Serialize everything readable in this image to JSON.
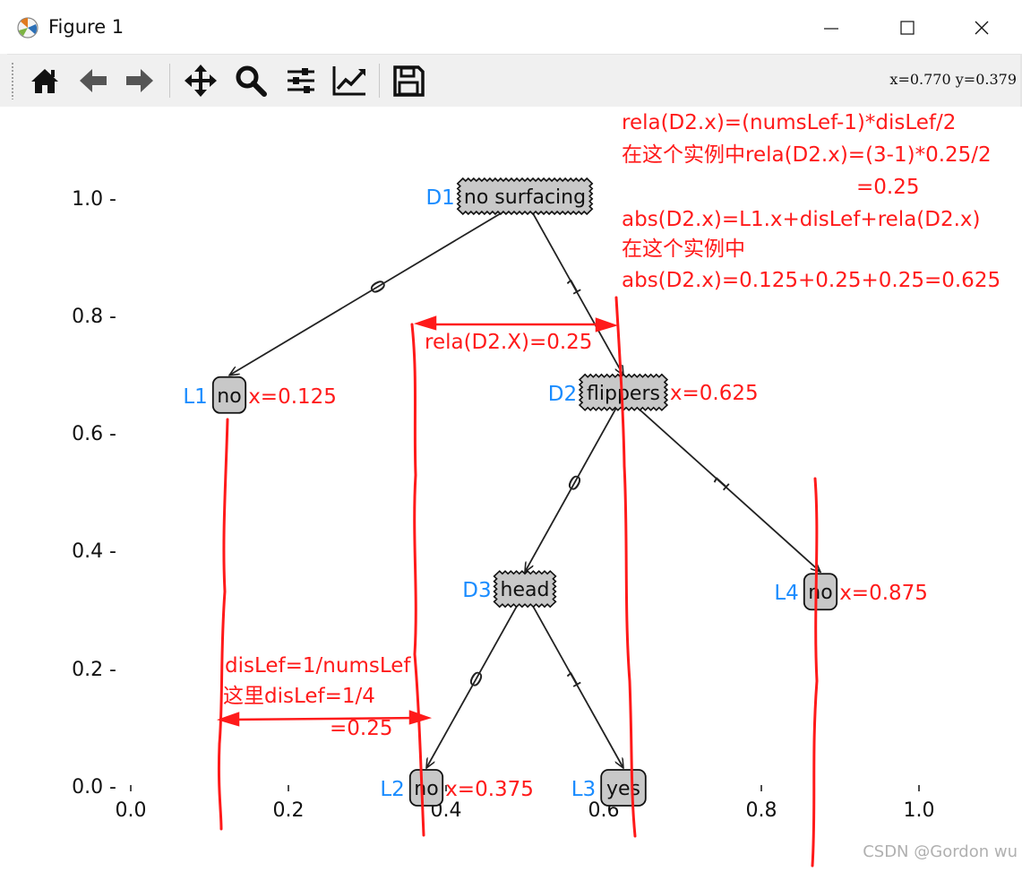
{
  "window": {
    "title": "Figure 1",
    "coords_readout": "x=0.770  y=0.379",
    "watermark": "CSDN @Gordon wu"
  },
  "toolbar": {
    "buttons": [
      {
        "icon": "home-icon",
        "name": "home-button"
      },
      {
        "icon": "back-arrow-icon",
        "name": "back-button"
      },
      {
        "icon": "forward-arrow-icon",
        "name": "forward-button"
      },
      {
        "icon": "pan-icon",
        "name": "pan-button"
      },
      {
        "icon": "zoom-icon",
        "name": "zoom-button"
      },
      {
        "icon": "subplots-icon",
        "name": "subplots-button"
      },
      {
        "icon": "edit-axis-icon",
        "name": "edit-axis-button"
      },
      {
        "icon": "save-icon",
        "name": "save-button"
      }
    ]
  },
  "chart_data": {
    "type": "tree-plot",
    "xticks": [
      "0.0",
      "0.2",
      "0.4",
      "0.6",
      "0.8",
      "1.0"
    ],
    "yticks": [
      "0.0 -",
      "0.2 -",
      "0.4 -",
      "0.6 -",
      "0.8 -",
      "1.0 -"
    ],
    "xlim": [
      0.0,
      1.0
    ],
    "ylim": [
      0.0,
      1.0
    ],
    "decision_nodes": [
      {
        "id": "D1",
        "label": "no surfacing",
        "x": 0.5,
        "y": 1.0
      },
      {
        "id": "D2",
        "label": "flippers",
        "x": 0.625,
        "y": 0.667
      },
      {
        "id": "D3",
        "label": "head",
        "x": 0.5,
        "y": 0.333
      }
    ],
    "leaf_nodes": [
      {
        "id": "L1",
        "label": "no",
        "x": 0.125,
        "y": 0.667,
        "xnote": "x=0.125"
      },
      {
        "id": "L4",
        "label": "no",
        "x": 0.875,
        "y": 0.333,
        "xnote": "x=0.875"
      },
      {
        "id": "L2",
        "label": "no",
        "x": 0.375,
        "y": 0.0,
        "xnote": "x=0.375"
      },
      {
        "id": "L3",
        "label": "yes",
        "x": 0.625,
        "y": 0.0,
        "xnote": ""
      }
    ],
    "d2_xnote": "x=0.625",
    "edges": [
      {
        "from": "D1",
        "to": "L1",
        "label": "0"
      },
      {
        "from": "D1",
        "to": "D2",
        "label": "1"
      },
      {
        "from": "D2",
        "to": "D3",
        "label": "0"
      },
      {
        "from": "D2",
        "to": "L4",
        "label": "1"
      },
      {
        "from": "D3",
        "to": "L2",
        "label": "0"
      },
      {
        "from": "D3",
        "to": "L3",
        "label": "1"
      }
    ]
  },
  "annotations": {
    "top_block": [
      "rela(D2.x)=(numsLef-1)*disLef/2",
      "在这个实例中rela(D2.x)=(3-1)*0.25/2",
      "=0.25",
      "abs(D2.x)=L1.x+disLef+rela(D2.x)",
      "在这个实例中",
      "abs(D2.x)=0.125+0.25+0.25=0.625"
    ],
    "rela_label": "rela(D2.X)=0.25",
    "dislef_block": [
      "disLef=1/numsLef",
      "这里disLef=1/4",
      "=0.25"
    ]
  },
  "colors": {
    "annotation_red": "#ff1a1a",
    "node_id_blue": "#1a8cff",
    "node_fill": "#c8c8c8"
  }
}
